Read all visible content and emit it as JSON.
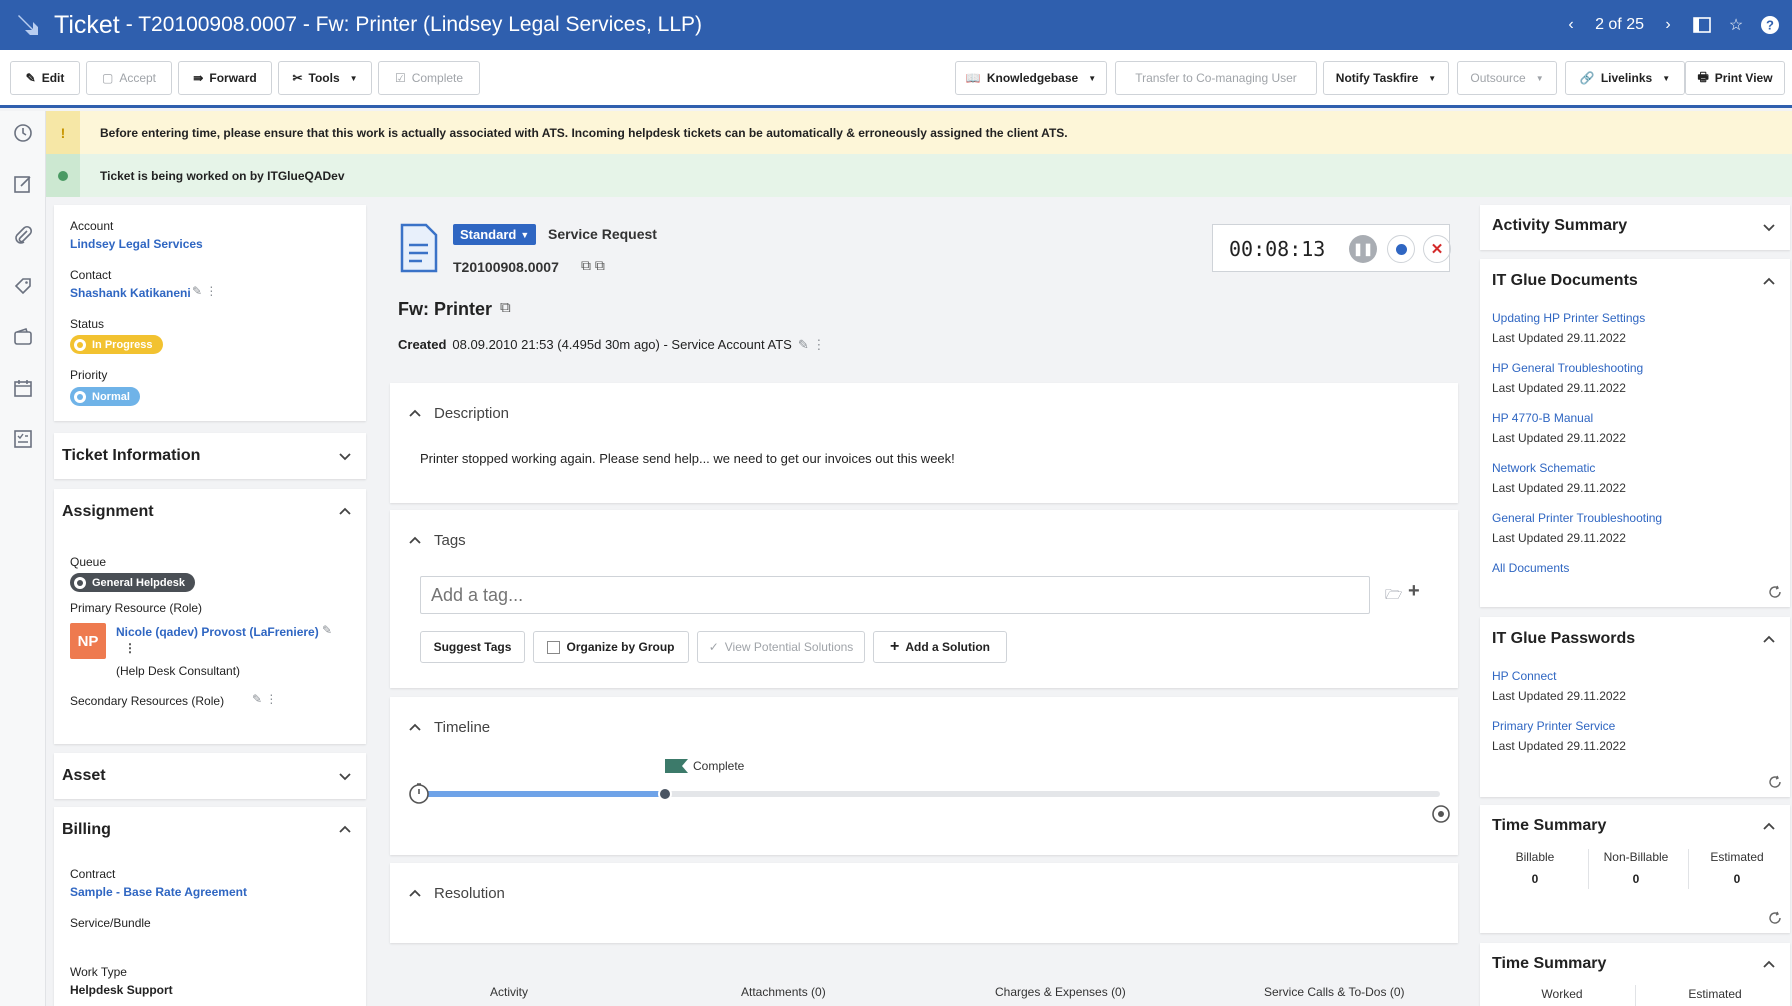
{
  "title_bar": {
    "ticket_word": "Ticket",
    "ticket_title": "- T20100908.0007 - Fw: Printer (Lindsey Legal Services, LLP)",
    "pager": "2 of 25"
  },
  "toolbar": {
    "edit": "Edit",
    "accept": "Accept",
    "forward": "Forward",
    "tools": "Tools",
    "complete": "Complete",
    "knowledgebase": "Knowledgebase",
    "transfer": "Transfer to Co-managing User",
    "notify": "Notify Taskfire",
    "outsource": "Outsource",
    "livelinks": "Livelinks",
    "print": "Print View"
  },
  "banners": {
    "warning": "Before entering time, please ensure that this work is actually associated with ATS.  Incoming helpdesk tickets can be automatically & erroneously assigned the client ATS.",
    "info": "Ticket is being worked on by ITGlueQADev"
  },
  "left": {
    "account_label": "Account",
    "account_value": "Lindsey Legal Services",
    "contact_label": "Contact",
    "contact_value": "Shashank Katikaneni",
    "status_label": "Status",
    "status_value": "In Progress",
    "priority_label": "Priority",
    "priority_value": "Normal",
    "ticket_info": "Ticket Information",
    "assignment": "Assignment",
    "queue_label": "Queue",
    "queue_value": "General Helpdesk",
    "primary_label": "Primary Resource (Role)",
    "avatar_initials": "NP",
    "primary_value": "Nicole (qadev) Provost (LaFreniere)",
    "primary_role": "(Help Desk Consultant)",
    "secondary_label": "Secondary Resources (Role)",
    "asset": "Asset",
    "billing": "Billing",
    "contract_label": "Contract",
    "contract_value": "Sample - Base Rate Agreement",
    "service_label": "Service/Bundle",
    "worktype_label": "Work Type",
    "worktype_value": "Helpdesk Support"
  },
  "main": {
    "type_badge": "Standard",
    "type_label": "Service Request",
    "ticket_number": "T20100908.0007",
    "timer": "00:08:13",
    "title": "Fw: Printer",
    "created_label": "Created",
    "created_value": "08.09.2010 21:53 (4.495d 30m ago) - Service Account ATS",
    "description_head": "Description",
    "description_text": "Printer stopped working again.  Please send help... we need to get our invoices out this week!",
    "tags_head": "Tags",
    "tag_placeholder": "Add a tag...",
    "suggest_tags": "Suggest Tags",
    "organize": "Organize by Group",
    "view_solutions": "View Potential Solutions",
    "add_solution": "Add a Solution",
    "timeline_head": "Timeline",
    "timeline_flag": "Complete",
    "timeline_progress": 0.24,
    "resolution_head": "Resolution",
    "tabs": [
      "Activity",
      "Attachments (0)",
      "Charges & Expenses (0)",
      "Service Calls & To-Dos (0)"
    ]
  },
  "right": {
    "activity_summary": "Activity Summary",
    "itg_docs": "IT Glue Documents",
    "docs": [
      {
        "name": "Updating HP Printer Settings",
        "updated": "Last Updated 29.11.2022"
      },
      {
        "name": "HP General Troubleshooting",
        "updated": "Last Updated 29.11.2022"
      },
      {
        "name": "HP 4770-B Manual",
        "updated": "Last Updated 29.11.2022"
      },
      {
        "name": "Network Schematic",
        "updated": "Last Updated 29.11.2022"
      },
      {
        "name": "General Printer Troubleshooting",
        "updated": "Last Updated 29.11.2022"
      }
    ],
    "all_docs": "All Documents",
    "itg_passwords": "IT Glue Passwords",
    "passwords": [
      {
        "name": "HP Connect",
        "updated": "Last Updated 29.11.2022"
      },
      {
        "name": "Primary Printer Service",
        "updated": "Last Updated 29.11.2022"
      }
    ],
    "time_summary": "Time Summary",
    "ts_billable": "Billable",
    "ts_billable_v": "0",
    "ts_nonbillable": "Non-Billable",
    "ts_nonbillable_v": "0",
    "ts_estimated": "Estimated",
    "ts_estimated_v": "0",
    "time_summary2": "Time Summary",
    "ts2_worked": "Worked",
    "ts2_estimated": "Estimated"
  },
  "colors": {
    "brand": "#2f5fae",
    "link": "#2f66c2",
    "status_in_progress": "#f2c230",
    "priority_normal": "#6fb3e8",
    "queue": "#4a4f55",
    "avatar": "#ee7a4f"
  }
}
